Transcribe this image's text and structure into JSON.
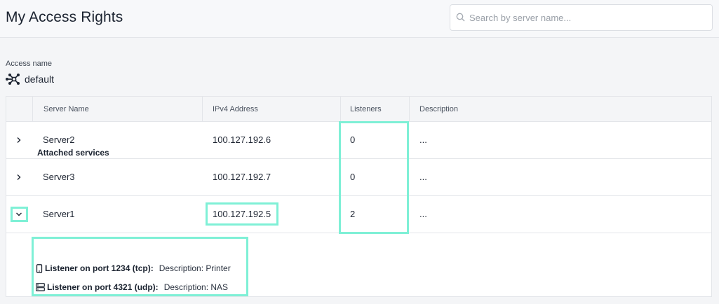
{
  "header": {
    "title": "My Access Rights",
    "search_placeholder": "Search by server name..."
  },
  "access": {
    "label": "Access name",
    "value": "default",
    "icon": "network-hub-icon"
  },
  "table": {
    "columns": [
      "Server Name",
      "IPv4 Address",
      "Listeners",
      "Description"
    ],
    "rows": [
      {
        "name": "Server2",
        "ip": "100.127.192.6",
        "listeners": "0",
        "description": "...",
        "expanded": false
      },
      {
        "name": "Server3",
        "ip": "100.127.192.7",
        "listeners": "0",
        "description": "...",
        "expanded": false
      },
      {
        "name": "Server1",
        "ip": "100.127.192.5",
        "listeners": "2",
        "description": "...",
        "expanded": true
      }
    ]
  },
  "attached": {
    "title": "Attached services",
    "services": [
      {
        "icon": "mobile-device-icon",
        "name": "Listener on port 1234 (tcp):",
        "description": "Description: Printer"
      },
      {
        "icon": "server-icon",
        "name": "Listener on port 4321 (udp):",
        "description": "Description: NAS"
      }
    ]
  },
  "colors": {
    "highlight": "#7ff0d6",
    "background": "#f4f5f7"
  }
}
